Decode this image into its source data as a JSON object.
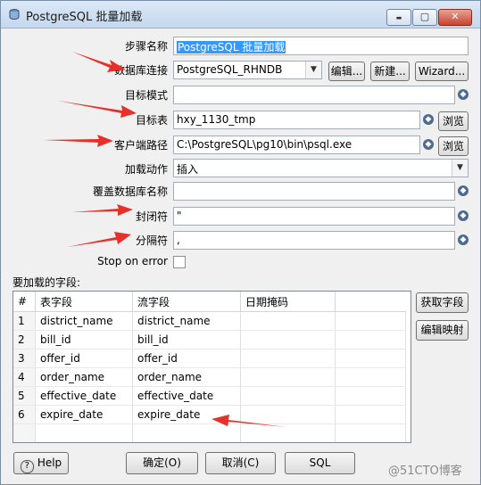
{
  "window": {
    "title": "PostgreSQL 批量加载",
    "minimize": "▬",
    "maximize": "▢",
    "close": "✕"
  },
  "form": {
    "step_name": {
      "label": "步骤名称",
      "value": "PostgreSQL 批量加载"
    },
    "connection": {
      "label": "数据库连接",
      "value": "PostgreSQL_RHNDB",
      "edit": "编辑...",
      "new": "新建...",
      "wizard": "Wizard..."
    },
    "target_schema": {
      "label": "目标模式",
      "value": ""
    },
    "target_table": {
      "label": "目标表",
      "value": "hxy_1130_tmp",
      "browse": "浏览"
    },
    "client_path": {
      "label": "客户端路径",
      "value": "C:\\PostgreSQL\\pg10\\bin\\psql.exe",
      "browse": "浏览"
    },
    "load_action": {
      "label": "加载动作",
      "value": "插入"
    },
    "override_db": {
      "label": "覆盖数据库名称",
      "value": ""
    },
    "enclosure": {
      "label": "封闭符",
      "value": "\""
    },
    "delimiter": {
      "label": "分隔符",
      "value": ","
    },
    "stop_on_error": {
      "label": "Stop on error",
      "checked": false
    }
  },
  "fields": {
    "label": "要加载的字段:",
    "columns": [
      "#",
      "表字段",
      "流字段",
      "日期掩码"
    ],
    "rows": [
      [
        "1",
        "district_name",
        "district_name",
        ""
      ],
      [
        "2",
        "bill_id",
        "bill_id",
        ""
      ],
      [
        "3",
        "offer_id",
        "offer_id",
        ""
      ],
      [
        "4",
        "order_name",
        "order_name",
        ""
      ],
      [
        "5",
        "effective_date",
        "effective_date",
        ""
      ],
      [
        "6",
        "expire_date",
        "expire_date",
        ""
      ]
    ],
    "get_fields": "获取字段",
    "edit_mapping": "编辑映射"
  },
  "footer": {
    "help": "Help",
    "ok": "确定(O)",
    "cancel": "取消(C)",
    "sql": "SQL"
  },
  "watermark": "@51CTO博客",
  "colors": {
    "arrow": "#e8302b",
    "selection": "#3399ff",
    "title_bar": "#c4d8ee"
  }
}
